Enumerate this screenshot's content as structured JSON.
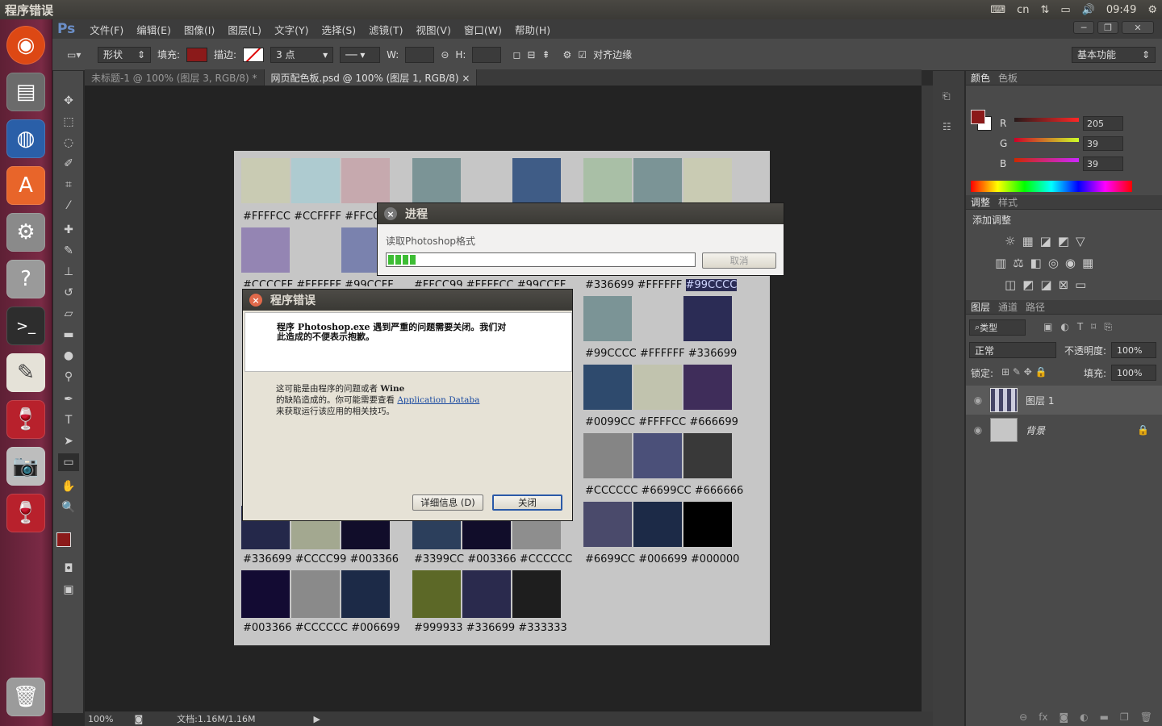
{
  "system": {
    "window_title": "程序错误",
    "language": "cn",
    "time": "09:49"
  },
  "menu": {
    "logo": "Ps",
    "items": [
      "文件(F)",
      "编辑(E)",
      "图像(I)",
      "图层(L)",
      "文字(Y)",
      "选择(S)",
      "滤镜(T)",
      "视图(V)",
      "窗口(W)",
      "帮助(H)"
    ]
  },
  "options": {
    "mode": "形状",
    "fill_label": "填充:",
    "fill_color": "#8b1a1a",
    "stroke_label": "描边:",
    "stroke_size": "3 点",
    "w_label": "W:",
    "h_label": "H:",
    "align_edges": "对齐边缘",
    "workspace": "基本功能"
  },
  "tabs": [
    {
      "label": "未标题-1 @ 100% (图层 3, RGB/8) *"
    },
    {
      "label": "网页配色板.psd @ 100% (图层 1, RGB/8)"
    }
  ],
  "status": {
    "zoom": "100%",
    "doc": "文档:1.16M/1.16M"
  },
  "swatches": {
    "g1": {
      "colors": [
        "#c9cbb3",
        "#aecbd0",
        "#c6a9ae",
        "#9485b3",
        "#c6c6c6",
        "#7a82ae"
      ],
      "row1": "#FFFFCC  #CCFFFF  #FFCC",
      "row2": "#CCCCFF  #FFFFFF  #99CCFF"
    },
    "g2": {
      "colors": [
        "#7b9496",
        "#c6c6c6",
        "#3f5c86"
      ],
      "row2": "#FFCC99  #FFFFCC  #99CCFF"
    },
    "g3": {
      "row1_colors": [
        "#a9bfa6",
        "#7b9496",
        "#c9cbb3"
      ],
      "row2_label_a": "#336699  #FFFFFF",
      "row2_label_b": "#99CCCC",
      "rows": [
        {
          "colors": [
            "#7b9496",
            "#c6c6c6",
            "#2b2c55"
          ],
          "label": "#99CCCC  #FFFFFF  #336699"
        },
        {
          "colors": [
            "#2e4a6d",
            "#c1c3ae",
            "#3f2d5a"
          ],
          "label": "#0099CC  #FFFFCC  #666699"
        },
        {
          "colors": [
            "#858585",
            "#4b5079",
            "#393939"
          ],
          "label": "#CCCCCC  #6699CC  #666666"
        },
        {
          "colors": [
            "#4a4a6b",
            "#1c2a47",
            "#000000"
          ],
          "label": "#6699CC  #006699  #000000"
        }
      ]
    },
    "g4": {
      "colors": [
        "#24284a",
        "#a3a890",
        "#110d2a"
      ],
      "label": "#336699  #CCCC99  #003366"
    },
    "g5": {
      "colors": [
        "#2c3f5c",
        "#110d2a",
        "#8e8e8e"
      ],
      "label": "#3399CC  #003366  #CCCCCC"
    },
    "g6": {
      "colors": [
        "#130b33",
        "#8a8a8a",
        "#1c2a47"
      ],
      "label": "#003366  #CCCCCC  #006699"
    },
    "g7": {
      "colors": [
        "#5c6827",
        "#2a2a4d",
        "#1e1e1e"
      ],
      "label": "#999933  #336699  #333333"
    }
  },
  "progress": {
    "title": "进程",
    "message": "读取Photoshop格式",
    "percent": 9,
    "cancel": "取消"
  },
  "error": {
    "title": "程序错误",
    "main_line1": "程序 Photoshop.exe 遇到严重的问题需要关闭。我们对",
    "main_line2": "此造成的不便表示抱歉。",
    "info_line1_a": "这可能是由程序的问题或者 ",
    "info_line1_b": "Wine",
    "info_line2_a": "的缺陷造成的。你可能需要查看 ",
    "info_link": "Application Databa",
    "info_line3": "来获取运行该应用的相关技巧。",
    "details": "详细信息 (D)",
    "close": "关闭"
  },
  "color_panel": {
    "tab1": "颜色",
    "tab2": "色板",
    "fg": "#8b1a1a",
    "r_label": "R",
    "g_label": "G",
    "b_label": "B",
    "r": "205",
    "g": "39",
    "b": "39"
  },
  "adjust_panel": {
    "tab1": "调整",
    "tab2": "样式",
    "add": "添加调整"
  },
  "layers_panel": {
    "tabs": [
      "图层",
      "通道",
      "路径"
    ],
    "kind": "类型",
    "blend": "正常",
    "opacity_label": "不透明度:",
    "opacity": "100%",
    "lock_label": "锁定:",
    "fill_label": "填充:",
    "fill": "100%",
    "layers": [
      {
        "name": "图层 1"
      },
      {
        "name": "背景"
      }
    ]
  }
}
